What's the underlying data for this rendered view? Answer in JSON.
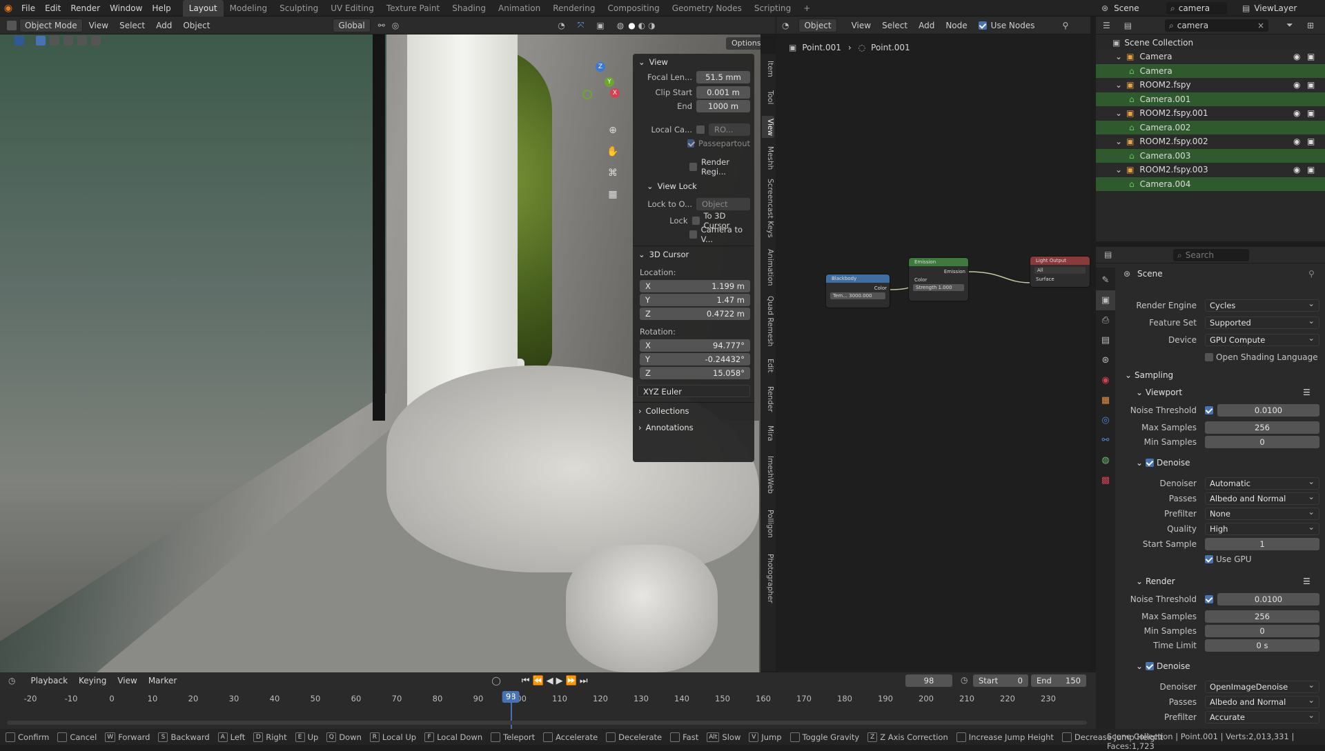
{
  "topbar": {
    "menus": [
      "File",
      "Edit",
      "Render",
      "Window",
      "Help"
    ],
    "workspaces": [
      "Layout",
      "Modeling",
      "Sculpting",
      "UV Editing",
      "Texture Paint",
      "Shading",
      "Animation",
      "Rendering",
      "Compositing",
      "Geometry Nodes",
      "Scripting"
    ],
    "active_workspace": "Layout",
    "add_tab": "+",
    "scene_label": "Scene",
    "search_value": "camera",
    "viewlayer_label": "ViewLayer"
  },
  "viewport_header": {
    "mode": "Object Mode",
    "menus": [
      "View",
      "Select",
      "Add",
      "Object"
    ],
    "transform": "Global",
    "options": "Options"
  },
  "npanel": {
    "view_title": "View",
    "focal_label": "Focal Len...",
    "focal_value": "51.5 mm",
    "clip_start_label": "Clip Start",
    "clip_start_value": "0.001 m",
    "end_label": "End",
    "end_value": "1000 m",
    "local_cam_label": "Local Ca...",
    "local_cam_value": "RO...",
    "passepartout": "Passepartout",
    "render_region": "Render Regi...",
    "view_lock_title": "View Lock",
    "lock_to_label": "Lock to O...",
    "lock_to_value": "Object",
    "lock_label": "Lock",
    "to_cursor": "To 3D Cursor",
    "camera_to_view": "Camera to V...",
    "cursor_title": "3D Cursor",
    "location_label": "Location:",
    "loc_x": "1.199 m",
    "loc_y": "1.47 m",
    "loc_z": "0.4722 m",
    "rotation_label": "Rotation:",
    "rot_x": "94.777°",
    "rot_y": "-0.24432°",
    "rot_z": "15.058°",
    "rot_mode": "XYZ Euler",
    "collections": "Collections",
    "annotations": "Annotations",
    "axis_x": "X",
    "axis_y": "Y",
    "axis_z": "Z"
  },
  "side_tabs": [
    "Item",
    "Tool",
    "View",
    "Meshh",
    "Screencast Keys",
    "Animation",
    "Quad Remesh",
    "Edit",
    "Render",
    "Mira",
    "ImeshWeb",
    "Polligon",
    "Photographer"
  ],
  "node_header": {
    "type": "Object",
    "menus": [
      "View",
      "Select",
      "Add",
      "Node"
    ],
    "use_nodes": "Use Nodes",
    "breadcrumb_1": "Point.001",
    "breadcrumb_2": "Point.001"
  },
  "nodes": {
    "blackbody": {
      "title": "Blackbody",
      "out": "Color",
      "field": "Tem...  3000.000"
    },
    "emission": {
      "title": "Emission",
      "out": "Emission",
      "color": "Color",
      "strength": "Strength  1.000"
    },
    "light_output": {
      "title": "Light Output",
      "target": "All",
      "surface": "Surface"
    }
  },
  "outliner": {
    "root": "Scene Collection",
    "rows": [
      {
        "label": "Camera",
        "level": 1,
        "type": "collection"
      },
      {
        "label": "Camera",
        "level": 2,
        "type": "camera"
      },
      {
        "label": "ROOM2.fspy",
        "level": 1,
        "type": "collection"
      },
      {
        "label": "Camera.001",
        "level": 2,
        "type": "camera"
      },
      {
        "label": "ROOM2.fspy.001",
        "level": 1,
        "type": "collection"
      },
      {
        "label": "Camera.002",
        "level": 2,
        "type": "camera"
      },
      {
        "label": "ROOM2.fspy.002",
        "level": 1,
        "type": "collection"
      },
      {
        "label": "Camera.003",
        "level": 2,
        "type": "camera"
      },
      {
        "label": "ROOM2.fspy.003",
        "level": 1,
        "type": "collection"
      },
      {
        "label": "Camera.004",
        "level": 2,
        "type": "camera"
      }
    ]
  },
  "properties": {
    "search_placeholder": "Search",
    "scene_title": "Scene",
    "render_engine_label": "Render Engine",
    "render_engine": "Cycles",
    "feature_set_label": "Feature Set",
    "feature_set": "Supported",
    "device_label": "Device",
    "device": "GPU Compute",
    "osl": "Open Shading Language",
    "sampling": "Sampling",
    "viewport": "Viewport",
    "noise_threshold_label": "Noise Threshold",
    "vp_noise": "0.0100",
    "max_samples_label": "Max Samples",
    "vp_max": "256",
    "min_samples_label": "Min Samples",
    "vp_min": "0",
    "denoise": "Denoise",
    "denoiser_label": "Denoiser",
    "vp_denoiser": "Automatic",
    "passes_label": "Passes",
    "vp_passes": "Albedo and Normal",
    "prefilter_label": "Prefilter",
    "vp_prefilter": "None",
    "quality_label": "Quality",
    "vp_quality": "High",
    "start_sample_label": "Start Sample",
    "vp_start": "1",
    "use_gpu": "Use GPU",
    "render": "Render",
    "r_noise": "0.0100",
    "r_max": "256",
    "r_min": "0",
    "time_limit_label": "Time Limit",
    "r_time": "0 s",
    "r_denoiser": "OpenImageDenoise",
    "r_passes": "Albedo and Normal",
    "r_prefilter": "Accurate"
  },
  "timeline": {
    "menus": [
      "Playback",
      "Keying",
      "View",
      "Marker"
    ],
    "current_frame": "98",
    "start_label": "Start",
    "start": "0",
    "end_label": "End",
    "end": "150",
    "ticks": [
      "-20",
      "-10",
      "0",
      "10",
      "20",
      "30",
      "40",
      "50",
      "60",
      "70",
      "80",
      "90",
      "100",
      "110",
      "120",
      "130",
      "140",
      "150",
      "160",
      "170",
      "180",
      "190",
      "200",
      "210",
      "220",
      "230"
    ]
  },
  "statusbar": {
    "hints": [
      {
        "key": "",
        "label": "Confirm"
      },
      {
        "key": "",
        "label": "Cancel"
      },
      {
        "key": "W",
        "label": "Forward"
      },
      {
        "key": "S",
        "label": "Backward"
      },
      {
        "key": "A",
        "label": "Left"
      },
      {
        "key": "D",
        "label": "Right"
      },
      {
        "key": "E",
        "label": "Up"
      },
      {
        "key": "Q",
        "label": "Down"
      },
      {
        "key": "R",
        "label": "Local Up"
      },
      {
        "key": "F",
        "label": "Local Down"
      },
      {
        "key": "",
        "label": "Teleport"
      },
      {
        "key": "",
        "label": "Accelerate"
      },
      {
        "key": "",
        "label": "Decelerate"
      },
      {
        "key": "",
        "label": "Fast"
      },
      {
        "key": "Alt",
        "label": "Slow"
      },
      {
        "key": "V",
        "label": "Jump"
      },
      {
        "key": "",
        "label": "Toggle Gravity"
      },
      {
        "key": "Z",
        "label": "Z Axis Correction"
      },
      {
        "key": "",
        "label": "Increase Jump Height"
      },
      {
        "key": "",
        "label": "Decrease Jump Height"
      }
    ],
    "info": "Scene Collection | Point.001 | Verts:2,013,331 | Faces:1,723"
  },
  "colors": {
    "accent": "#4772b3",
    "selection_green": "#2e5a2e",
    "frame_marker": "#4772b3"
  }
}
